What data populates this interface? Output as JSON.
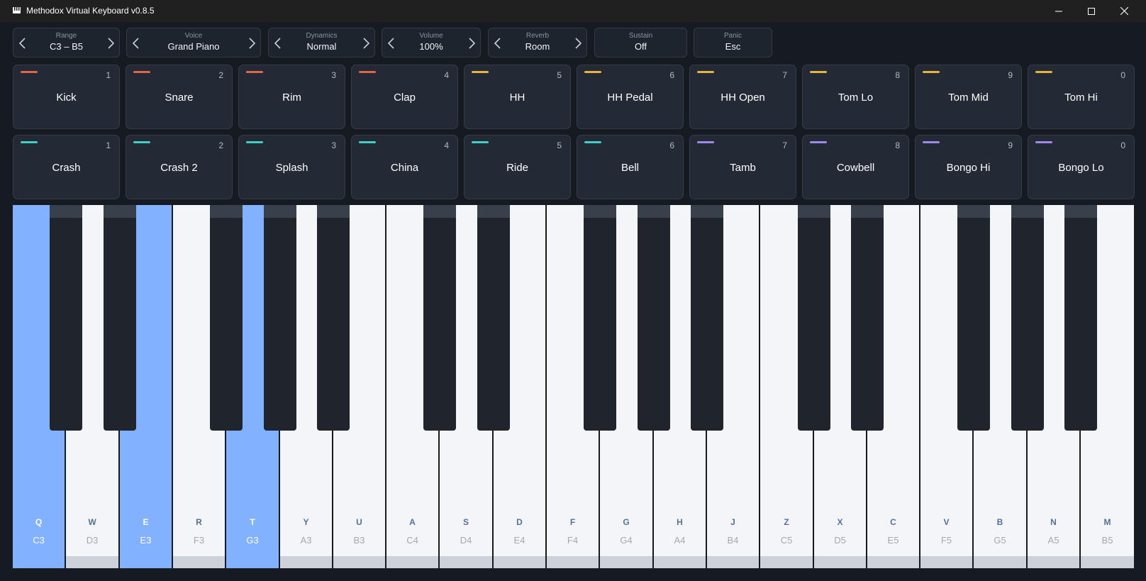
{
  "window": {
    "title": "Methodox Virtual Keyboard v0.8.5"
  },
  "controls": [
    {
      "label": "Range",
      "value": "C3 – B5",
      "arrows": true
    },
    {
      "label": "Voice",
      "value": "Grand Piano",
      "arrows": true
    },
    {
      "label": "Dynamics",
      "value": "Normal",
      "arrows": true
    },
    {
      "label": "Volume",
      "value": "100%",
      "arrows": true
    },
    {
      "label": "Reverb",
      "value": "Room",
      "arrows": true
    },
    {
      "label": "Sustain",
      "value": "Off",
      "arrows": false
    },
    {
      "label": "Panic",
      "value": "Esc",
      "arrows": false
    }
  ],
  "pad_rows": [
    [
      {
        "name": "Kick",
        "num": "1",
        "color": "#e0664a"
      },
      {
        "name": "Snare",
        "num": "2",
        "color": "#e0664a"
      },
      {
        "name": "Rim",
        "num": "3",
        "color": "#e0664a"
      },
      {
        "name": "Clap",
        "num": "4",
        "color": "#e0664a"
      },
      {
        "name": "HH",
        "num": "5",
        "color": "#e6b53a"
      },
      {
        "name": "HH Pedal",
        "num": "6",
        "color": "#e6b53a"
      },
      {
        "name": "HH Open",
        "num": "7",
        "color": "#e6b53a"
      },
      {
        "name": "Tom Lo",
        "num": "8",
        "color": "#e6b53a"
      },
      {
        "name": "Tom Mid",
        "num": "9",
        "color": "#e6b53a"
      },
      {
        "name": "Tom Hi",
        "num": "0",
        "color": "#e6b53a"
      }
    ],
    [
      {
        "name": "Crash",
        "num": "1",
        "color": "#40cfc0"
      },
      {
        "name": "Crash 2",
        "num": "2",
        "color": "#40cfc0"
      },
      {
        "name": "Splash",
        "num": "3",
        "color": "#40cfc0"
      },
      {
        "name": "China",
        "num": "4",
        "color": "#40cfc0"
      },
      {
        "name": "Ride",
        "num": "5",
        "color": "#40cfc0"
      },
      {
        "name": "Bell",
        "num": "6",
        "color": "#40cfc0"
      },
      {
        "name": "Tamb",
        "num": "7",
        "color": "#a08ae8"
      },
      {
        "name": "Cowbell",
        "num": "8",
        "color": "#a08ae8"
      },
      {
        "name": "Bongo Hi",
        "num": "9",
        "color": "#a08ae8"
      },
      {
        "name": "Bongo Lo",
        "num": "0",
        "color": "#a08ae8"
      }
    ]
  ],
  "white_keys": [
    {
      "key": "Q",
      "note": "C3",
      "pressed": true
    },
    {
      "key": "W",
      "note": "D3",
      "pressed": false
    },
    {
      "key": "E",
      "note": "E3",
      "pressed": true
    },
    {
      "key": "R",
      "note": "F3",
      "pressed": false
    },
    {
      "key": "T",
      "note": "G3",
      "pressed": true
    },
    {
      "key": "Y",
      "note": "A3",
      "pressed": false
    },
    {
      "key": "U",
      "note": "B3",
      "pressed": false
    },
    {
      "key": "A",
      "note": "C4",
      "pressed": false
    },
    {
      "key": "S",
      "note": "D4",
      "pressed": false
    },
    {
      "key": "D",
      "note": "E4",
      "pressed": false
    },
    {
      "key": "F",
      "note": "F4",
      "pressed": false
    },
    {
      "key": "G",
      "note": "G4",
      "pressed": false
    },
    {
      "key": "H",
      "note": "A4",
      "pressed": false
    },
    {
      "key": "J",
      "note": "B4",
      "pressed": false
    },
    {
      "key": "Z",
      "note": "C5",
      "pressed": false
    },
    {
      "key": "X",
      "note": "D5",
      "pressed": false
    },
    {
      "key": "C",
      "note": "E5",
      "pressed": false
    },
    {
      "key": "V",
      "note": "F5",
      "pressed": false
    },
    {
      "key": "B",
      "note": "G5",
      "pressed": false
    },
    {
      "key": "N",
      "note": "A5",
      "pressed": false
    },
    {
      "key": "M",
      "note": "B5",
      "pressed": false
    }
  ],
  "black_keys": [
    {
      "note": "C#3"
    },
    {
      "note": "D#3"
    },
    {
      "note": "F#3"
    },
    {
      "note": "G#3"
    },
    {
      "note": "A#3"
    },
    {
      "note": "C#4"
    },
    {
      "note": "D#4"
    },
    {
      "note": "F#4"
    },
    {
      "note": "G#4"
    },
    {
      "note": "A#4"
    },
    {
      "note": "C#5"
    },
    {
      "note": "D#5"
    },
    {
      "note": "F#5"
    },
    {
      "note": "G#5"
    },
    {
      "note": "A#5"
    }
  ],
  "colors": {
    "pressed": "#82b1ff",
    "accent_red": "#e0664a",
    "accent_yellow": "#e6b53a",
    "accent_teal": "#40cfc0",
    "accent_purple": "#a08ae8"
  }
}
